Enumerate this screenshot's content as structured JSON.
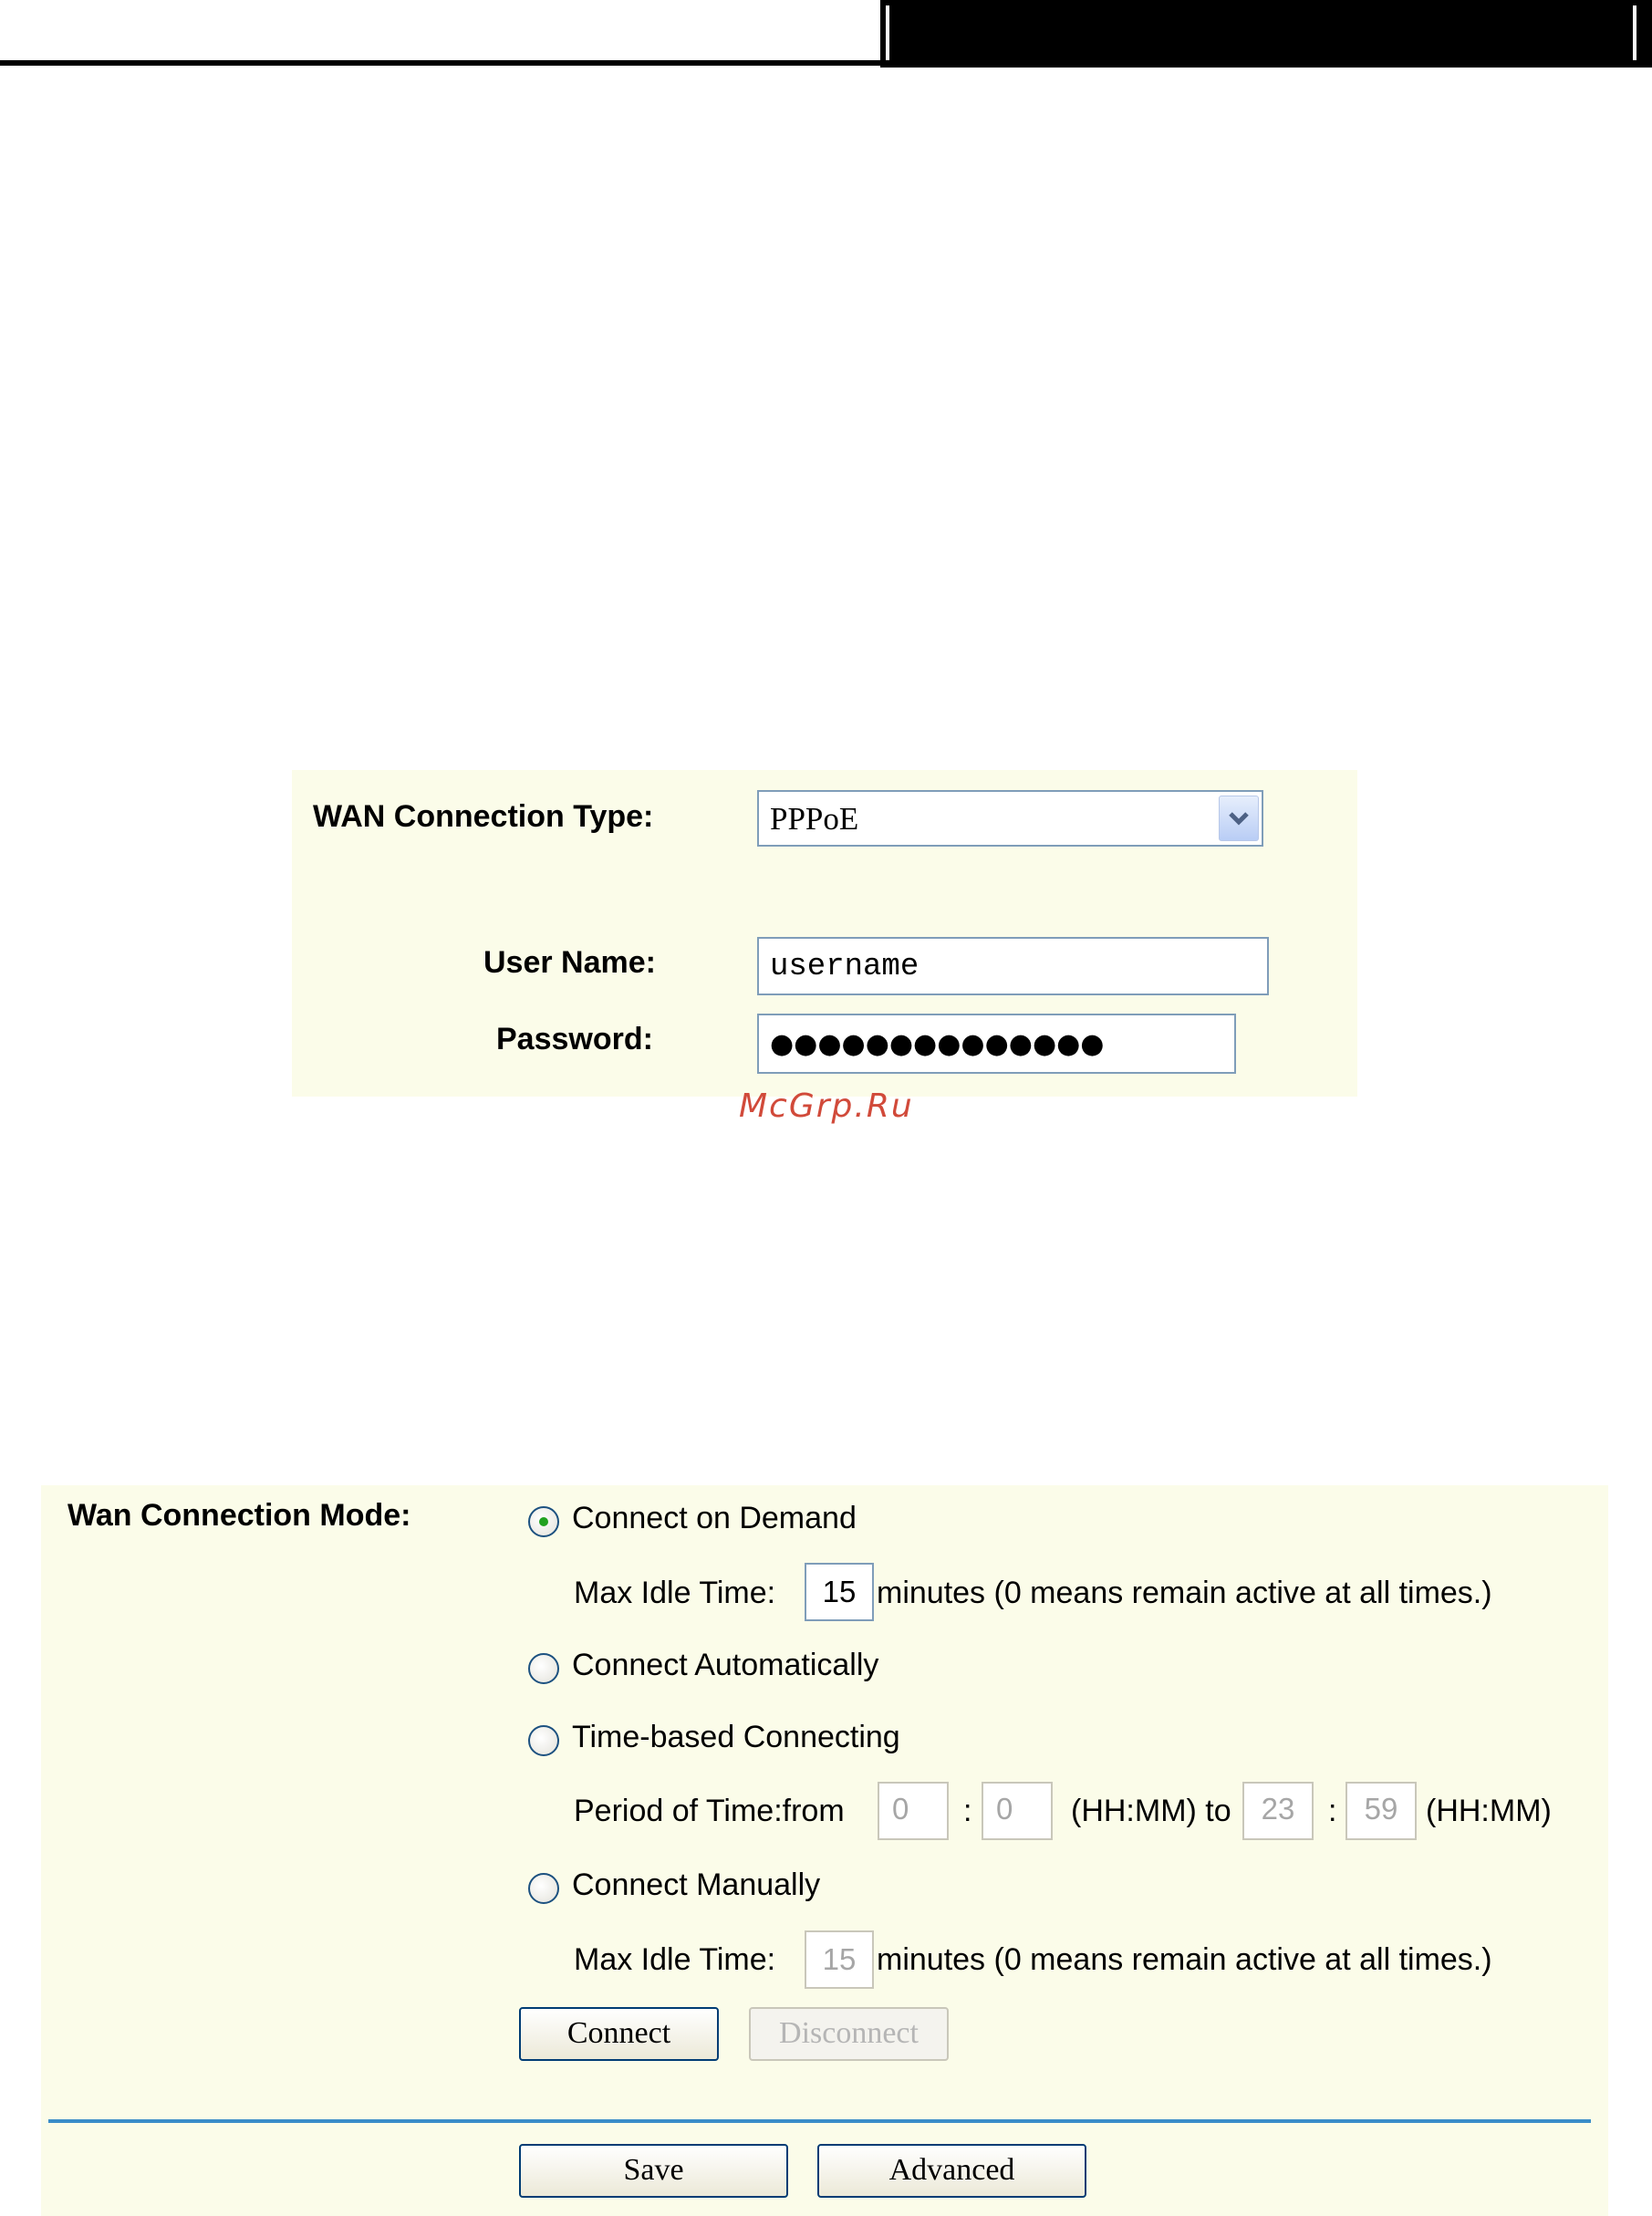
{
  "wan_form": {
    "connection_type_label": "WAN Connection Type:",
    "connection_type_value": "PPPoE",
    "user_name_label": "User Name:",
    "user_name_value": "username",
    "password_label": "Password:",
    "password_value": "●●●●●●●●●●●●●●"
  },
  "watermark": "McGrp.Ru",
  "mode_panel": {
    "mode_label": "Wan Connection Mode:",
    "options": [
      {
        "label": "Connect on Demand",
        "selected": true
      },
      {
        "label": "Connect Automatically",
        "selected": false
      },
      {
        "label": "Time-based Connecting",
        "selected": false
      },
      {
        "label": "Connect Manually",
        "selected": false
      }
    ],
    "demand_idle": {
      "label": "Max Idle Time:",
      "value": "15",
      "suffix": "minutes (0 means remain active at all times.)"
    },
    "time_period": {
      "label": "Period of Time:from",
      "from_hh": "0",
      "from_mm": "0",
      "sep": ":",
      "mid": "(HH:MM) to",
      "to_hh": "23",
      "to_mm": "59",
      "end": "(HH:MM)"
    },
    "manual_idle": {
      "label": "Max Idle Time:",
      "value": "15",
      "suffix": "minutes (0 means remain active at all times.)"
    },
    "connect_label": "Connect",
    "disconnect_label": "Disconnect",
    "save_label": "Save",
    "advanced_label": "Advanced"
  },
  "colors": {
    "panel_bg": "#fbfce9",
    "divider": "#3a8dc8",
    "radio_selected_dot": "#21a121",
    "watermark": "#d14a3a"
  }
}
